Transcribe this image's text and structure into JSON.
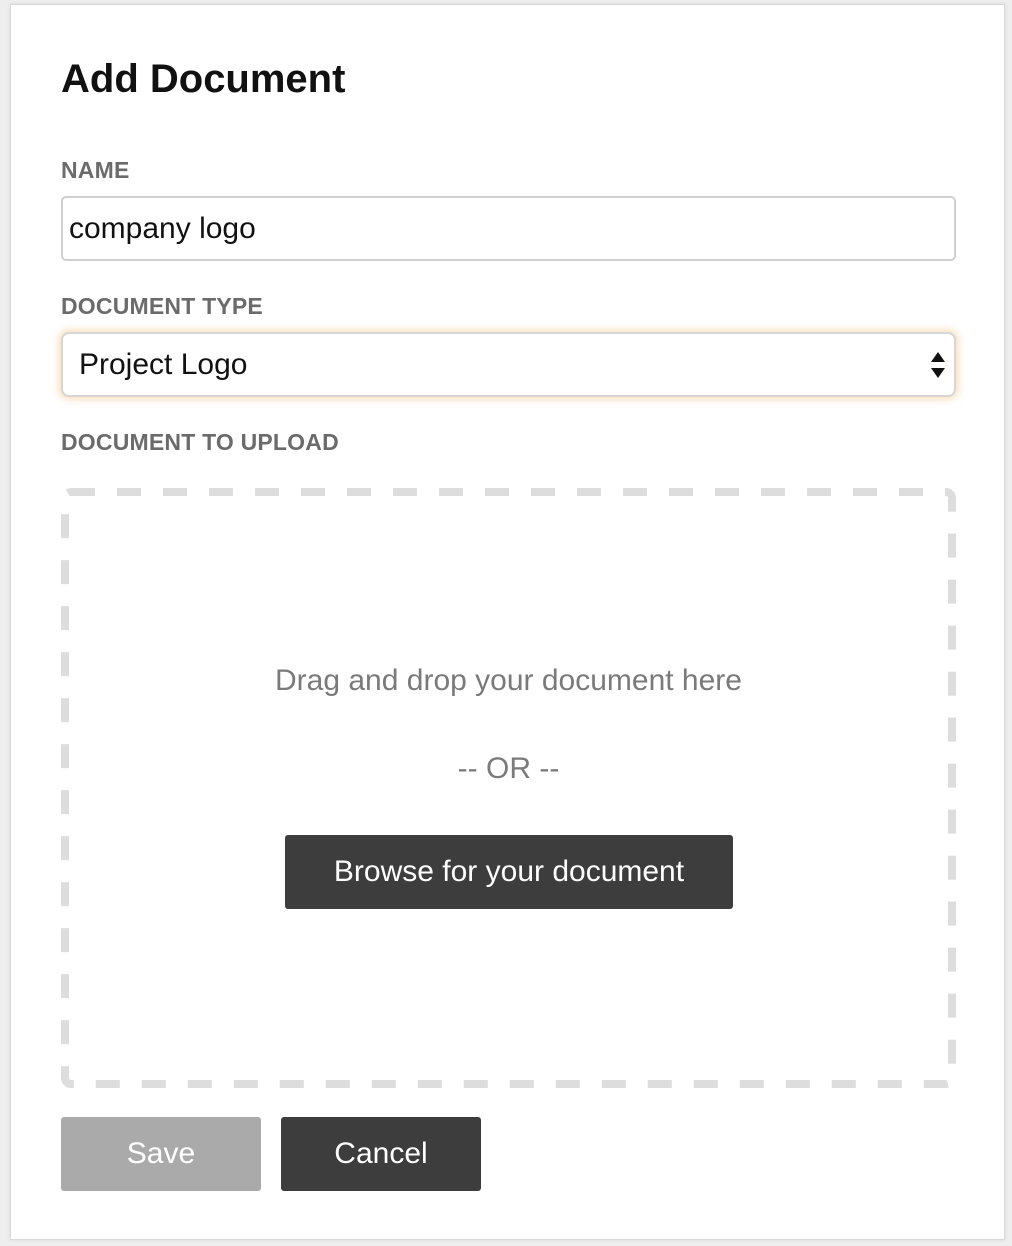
{
  "dialog": {
    "title": "Add Document"
  },
  "form": {
    "name": {
      "label": "NAME",
      "value": "company logo"
    },
    "document_type": {
      "label": "DOCUMENT TYPE",
      "selected": "Project Logo"
    },
    "upload": {
      "label": "DOCUMENT TO UPLOAD",
      "drag_text": "Drag and drop your document here",
      "or_text": "-- OR --",
      "browse_label": "Browse for your document"
    }
  },
  "actions": {
    "save_label": "Save",
    "cancel_label": "Cancel"
  },
  "colors": {
    "dark_button": "#3d3d3d",
    "disabled_button": "#aaaaaa",
    "focus_glow": "#f4be78",
    "label_gray": "#6b6b6b"
  },
  "icons": {
    "select_arrows": "select-arrows-icon"
  }
}
